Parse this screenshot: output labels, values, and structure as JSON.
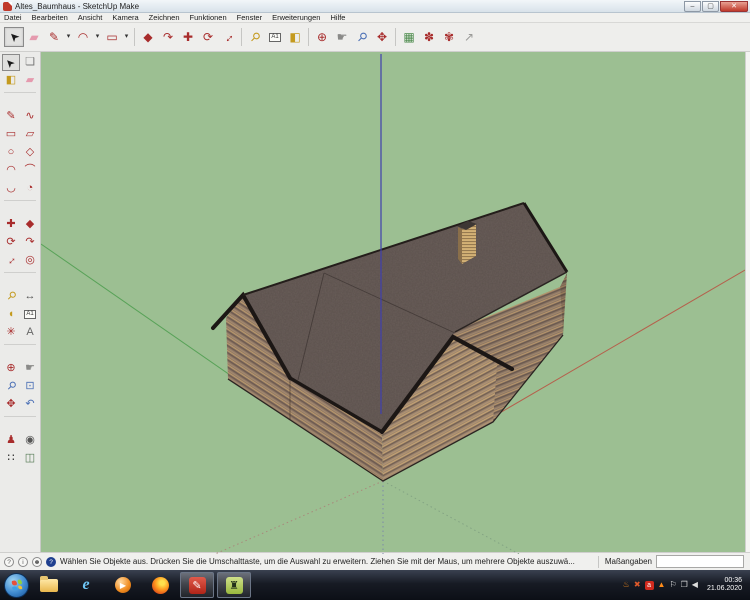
{
  "window": {
    "title": "Altes_Baumhaus - SketchUp Make",
    "controls": {
      "minimize": "–",
      "maximize": "▢",
      "close": "✕"
    }
  },
  "menu": {
    "items": [
      "Datei",
      "Bearbeiten",
      "Ansicht",
      "Kamera",
      "Zeichnen",
      "Funktionen",
      "Fenster",
      "Erweiterungen",
      "Hilfe"
    ]
  },
  "toolbar": {
    "items": [
      {
        "name": "select-tool",
        "glyph": "➤",
        "color": "#1a1a1a",
        "rot": -135,
        "pressed": true
      },
      {
        "name": "eraser-tool",
        "glyph": "▰",
        "color": "#e59aae"
      },
      {
        "name": "line-tool",
        "glyph": "✎",
        "color": "#a82c2c"
      },
      {
        "name": "line-dropdown",
        "drop": true,
        "glyph": "▾"
      },
      {
        "name": "arc-tool",
        "glyph": "◠",
        "color": "#a82c2c"
      },
      {
        "name": "arc-dropdown",
        "drop": true,
        "glyph": "▾"
      },
      {
        "name": "rectangle-tool",
        "glyph": "▭",
        "color": "#a82c2c"
      },
      {
        "name": "rectangle-dropdown",
        "drop": true,
        "glyph": "▾"
      },
      {
        "sep": true
      },
      {
        "name": "pushpull-tool",
        "glyph": "◆",
        "color": "#a82c2c"
      },
      {
        "name": "followme-tool",
        "glyph": "↷",
        "color": "#a82c2c"
      },
      {
        "name": "move-tool",
        "glyph": "✚",
        "color": "#a82c2c"
      },
      {
        "name": "rotate-tool",
        "glyph": "⟳",
        "color": "#a82c2c"
      },
      {
        "name": "scale-tool",
        "glyph": "↔",
        "color": "#a82c2c",
        "rot": -45
      },
      {
        "sep": true
      },
      {
        "name": "tape-measure-tool",
        "glyph": "⚲",
        "color": "#c49a1e",
        "rot": 45
      },
      {
        "name": "text-tool",
        "glyph": "A1",
        "color": "#333",
        "boxed": true
      },
      {
        "name": "paint-bucket-tool",
        "glyph": "◧",
        "color": "#c49a1e"
      },
      {
        "sep": true
      },
      {
        "name": "orbit-tool",
        "glyph": "⊕",
        "color": "#a82c2c"
      },
      {
        "name": "pan-tool",
        "glyph": "☛",
        "color": "#8a8a88"
      },
      {
        "name": "zoom-tool",
        "glyph": "⚲",
        "color": "#4a6fb5",
        "rot": 45
      },
      {
        "name": "zoom-extents-tool",
        "glyph": "✥",
        "color": "#a82c2c"
      },
      {
        "sep": true
      },
      {
        "name": "get-models-icon",
        "glyph": "▦",
        "color": "#4a8a4a"
      },
      {
        "name": "share-model-icon",
        "glyph": "✽",
        "color": "#a82c2c"
      },
      {
        "name": "share-component-icon",
        "glyph": "✾",
        "color": "#a82c2c"
      },
      {
        "name": "layout-export-icon",
        "glyph": "↗",
        "color": "#9a9a98"
      }
    ]
  },
  "sidebar": {
    "items": [
      {
        "name": "select-tool",
        "glyph": "➤",
        "color": "#1a1a1a",
        "rot": -135,
        "pressed": true
      },
      {
        "name": "make-component-tool",
        "glyph": "❏",
        "color": "#777"
      },
      {
        "name": "paint-bucket-tool",
        "glyph": "◧",
        "color": "#c49a1e"
      },
      {
        "name": "eraser-tool",
        "glyph": "▰",
        "color": "#e59aae"
      },
      {
        "brk": true
      },
      {
        "name": "line-tool",
        "glyph": "✎",
        "color": "#a82c2c"
      },
      {
        "name": "freehand-tool",
        "glyph": "∿",
        "color": "#a82c2c"
      },
      {
        "name": "rectangle-tool",
        "glyph": "▭",
        "color": "#a82c2c"
      },
      {
        "name": "rotated-rectangle-tool",
        "glyph": "▱",
        "color": "#a82c2c"
      },
      {
        "name": "circle-tool",
        "glyph": "○",
        "color": "#a82c2c"
      },
      {
        "name": "polygon-tool",
        "glyph": "◇",
        "color": "#a82c2c"
      },
      {
        "name": "arc-tool",
        "glyph": "◠",
        "color": "#a82c2c"
      },
      {
        "name": "two-point-arc-tool",
        "glyph": "⌒",
        "color": "#a82c2c"
      },
      {
        "name": "three-point-arc-tool",
        "glyph": "◡",
        "color": "#a82c2c"
      },
      {
        "name": "pie-tool",
        "glyph": "◔",
        "color": "#a82c2c"
      },
      {
        "brk": true
      },
      {
        "name": "move-tool",
        "glyph": "✚",
        "color": "#a82c2c"
      },
      {
        "name": "pushpull-tool",
        "glyph": "◆",
        "color": "#a82c2c"
      },
      {
        "name": "rotate-tool",
        "glyph": "⟳",
        "color": "#a82c2c"
      },
      {
        "name": "followme-tool",
        "glyph": "↷",
        "color": "#a82c2c"
      },
      {
        "name": "scale-tool",
        "glyph": "↔",
        "color": "#a82c2c",
        "rot": -45
      },
      {
        "name": "offset-tool",
        "glyph": "◎",
        "color": "#a82c2c"
      },
      {
        "brk": true
      },
      {
        "name": "tape-measure-tool",
        "glyph": "⚲",
        "color": "#c49a1e",
        "rot": 45
      },
      {
        "name": "dimension-tool",
        "glyph": "↔",
        "color": "#555"
      },
      {
        "name": "protractor-tool",
        "glyph": "◖",
        "color": "#c49a1e"
      },
      {
        "name": "text-tool",
        "glyph": "A1",
        "color": "#333",
        "boxed": true
      },
      {
        "name": "axes-tool",
        "glyph": "✳",
        "color": "#a82c2c"
      },
      {
        "name": "threed-text-tool",
        "glyph": "A",
        "color": "#666"
      },
      {
        "brk": true
      },
      {
        "name": "orbit-tool",
        "glyph": "⊕",
        "color": "#a82c2c"
      },
      {
        "name": "pan-tool",
        "glyph": "☛",
        "color": "#8a8a88"
      },
      {
        "name": "zoom-tool",
        "glyph": "⚲",
        "color": "#4a6fb5",
        "rot": 45
      },
      {
        "name": "zoom-window-tool",
        "glyph": "⊡",
        "color": "#4a6fb5"
      },
      {
        "name": "zoom-extents-tool",
        "glyph": "✥",
        "color": "#a82c2c"
      },
      {
        "name": "previous-view-tool",
        "glyph": "↶",
        "color": "#4a6fb5"
      },
      {
        "brk": true
      },
      {
        "name": "position-camera-tool",
        "glyph": "♟",
        "color": "#a82c2c"
      },
      {
        "name": "look-around-tool",
        "glyph": "◉",
        "color": "#555"
      },
      {
        "name": "walk-tool",
        "glyph": "∷",
        "color": "#222"
      },
      {
        "name": "section-plane-tool",
        "glyph": "◫",
        "color": "#557a55"
      }
    ]
  },
  "statusbar": {
    "icons": [
      {
        "name": "geolocation-icon",
        "glyph": "?"
      },
      {
        "name": "model-info-icon",
        "glyph": "i"
      },
      {
        "name": "credits-icon",
        "glyph": "☻"
      },
      {
        "name": "help-icon",
        "glyph": "?",
        "filled": true
      }
    ],
    "status_text": "Wählen Sie Objekte aus. Drücken Sie die Umschalttaste, um die Auswahl zu erweitern. Ziehen Sie mit der Maus, um mehrere Objekte auszuwä...",
    "measure_label": "Maßangaben",
    "measure_value": ""
  },
  "taskbar": {
    "apps": [
      {
        "name": "explorer-icon",
        "icon": "folder",
        "active": false
      },
      {
        "name": "internet-explorer-icon",
        "icon": "ie",
        "glyph": "e",
        "active": false
      },
      {
        "name": "media-player-icon",
        "icon": "wmp",
        "glyph": "▶",
        "active": false
      },
      {
        "name": "firefox-icon",
        "icon": "ff",
        "active": false
      },
      {
        "name": "sketchup-icon",
        "icon": "su",
        "glyph": "✎",
        "active": true
      },
      {
        "name": "train-app-icon",
        "icon": "train",
        "glyph": "♜",
        "active": true
      }
    ],
    "tray": [
      {
        "name": "ccleaner-icon",
        "glyph": "♨",
        "color": "#f08a1d"
      },
      {
        "name": "avast-icon",
        "glyph": "✖",
        "color": "#e05a2b"
      },
      {
        "name": "anydesk-icon",
        "glyph": "a",
        "square": true
      },
      {
        "name": "vlc-icon",
        "glyph": "▲",
        "color": "#ff8c1a"
      },
      {
        "name": "action-center-flag-icon",
        "glyph": "⚐",
        "color": "#eee"
      },
      {
        "name": "display-icon",
        "glyph": "❐",
        "color": "#ddd"
      },
      {
        "name": "volume-icon",
        "glyph": "◀",
        "color": "#ddd"
      }
    ],
    "clock": {
      "time": "00:36",
      "date": "21.06.2020"
    }
  },
  "colors": {
    "vp-bg": "#9cbf92",
    "roof": "#6b5e5a",
    "trim": "#1c1715",
    "axis-red": "#b5604c",
    "axis-green": "#58a258",
    "axis-blue": "#3f3fae",
    "chimney-cap": "#3d3734"
  }
}
